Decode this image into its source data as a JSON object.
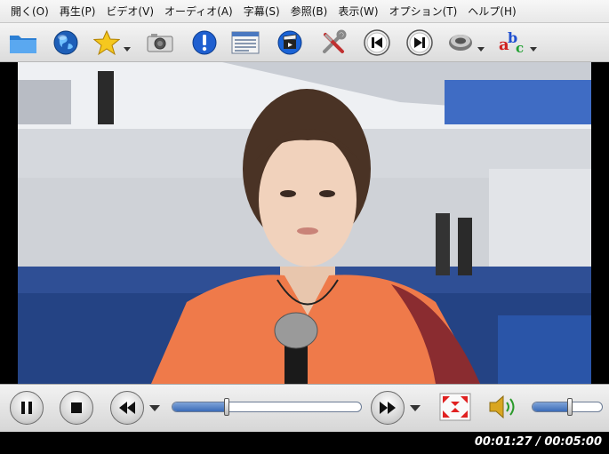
{
  "menu": [
    {
      "label": "開く(O)"
    },
    {
      "label": "再生(P)"
    },
    {
      "label": "ビデオ(V)"
    },
    {
      "label": "オーディオ(A)"
    },
    {
      "label": "字幕(S)"
    },
    {
      "label": "参照(B)"
    },
    {
      "label": "表示(W)"
    },
    {
      "label": "オプション(T)"
    },
    {
      "label": "ヘルプ(H)"
    }
  ],
  "toolbar_icons": [
    "folder-icon",
    "globe-icon",
    "star-favorites-icon",
    "camera-screenshot-icon",
    "info-icon",
    "playlist-icon",
    "video-clapper-icon",
    "tools-icon",
    "previous-track-icon",
    "next-track-icon",
    "audio-track-icon",
    "subtitles-abc-icon"
  ],
  "playback": {
    "current_time": "00:01:27",
    "total_time": "00:05:00",
    "time_display": "00:01:27 / 00:05:00",
    "progress": 0.29,
    "volume": 0.54
  },
  "colors": {
    "menubar_bg": "#eeeeee",
    "progress_fill": "#3b6cb8",
    "status_text": "#ffffff"
  }
}
